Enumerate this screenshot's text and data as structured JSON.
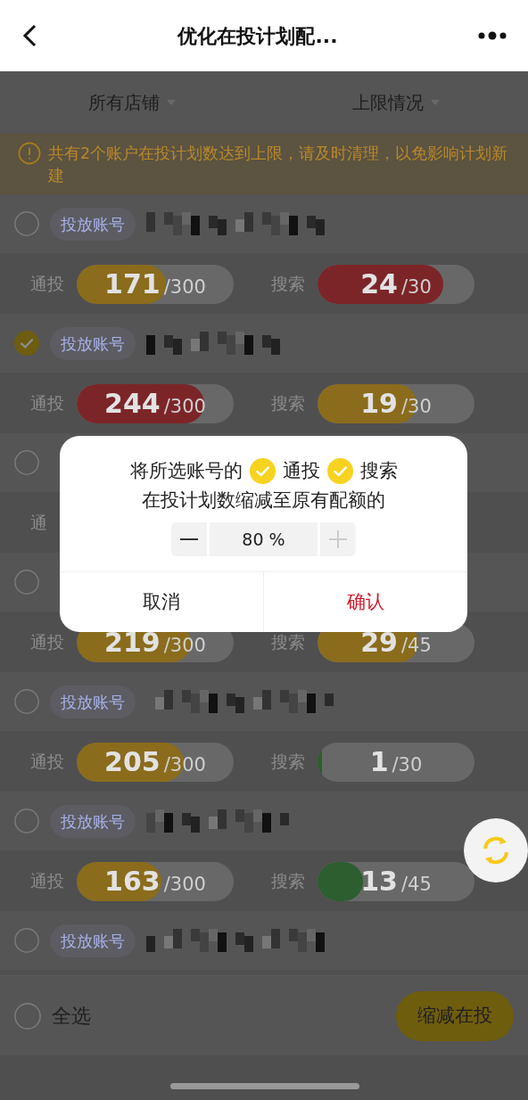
{
  "header": {
    "title": "优化在投计划配..."
  },
  "filters": [
    {
      "label": "所有店铺"
    },
    {
      "label": "上限情况"
    }
  ],
  "warning": {
    "text": "共有2个账户在投计划数达到上限，请及时清理，以免影响计划新建"
  },
  "accounts": [
    {
      "selected": false,
      "tag": "投放账号",
      "stats": [
        {
          "label": "通投",
          "value": "171",
          "total": "/300",
          "level": 0.57,
          "color": "#8a6c1c"
        },
        {
          "label": "搜索",
          "value": "24",
          "total": "/30",
          "level": 0.8,
          "color": "#7c2528"
        }
      ]
    },
    {
      "selected": true,
      "tag": "投放账号",
      "stats": [
        {
          "label": "通投",
          "value": "244",
          "total": "/300",
          "level": 0.81,
          "color": "#7c2528"
        },
        {
          "label": "搜索",
          "value": "19",
          "total": "/30",
          "level": 0.63,
          "color": "#8a6c1c"
        }
      ]
    },
    {
      "selected": false,
      "stats": [
        {
          "label": "通"
        }
      ]
    },
    {
      "selected": false,
      "stats": [
        {
          "label": "通投",
          "value": "219",
          "total": "/300",
          "level": 0.73,
          "color": "#8a6c1c"
        },
        {
          "label": "搜索",
          "value": "29",
          "total": "/45",
          "level": 0.64,
          "color": "#8a6c1c"
        }
      ]
    },
    {
      "selected": false,
      "tag": "投放账号",
      "stats": [
        {
          "label": "通投",
          "value": "205",
          "total": "/300",
          "level": 0.68,
          "color": "#8a6c1c"
        },
        {
          "label": "搜索",
          "value": "1",
          "total": "/30",
          "level": 0.03,
          "color": "#2c5e30"
        }
      ]
    },
    {
      "selected": false,
      "tag": "投放账号",
      "stats": [
        {
          "label": "通投",
          "value": "163",
          "total": "/300",
          "level": 0.54,
          "color": "#8a6c1c"
        },
        {
          "label": "搜索",
          "value": "13",
          "total": "/45",
          "level": 0.29,
          "color": "#2c5e30"
        }
      ]
    },
    {
      "selected": false,
      "tag": "投放账号"
    }
  ],
  "bottom_bar": {
    "select_all": {
      "label": "全选",
      "checked": false
    },
    "action": "缩减在投"
  },
  "dialog": {
    "prefix": "将所选账号的",
    "options": [
      {
        "label": "通投",
        "checked": true
      },
      {
        "label": "搜索",
        "checked": true
      }
    ],
    "line2": "在投计划数缩减至原有配额的",
    "stepper": {
      "value": "80 %",
      "minus_disabled": false,
      "plus_disabled": true
    },
    "cancel": "取消",
    "confirm": "确认"
  }
}
